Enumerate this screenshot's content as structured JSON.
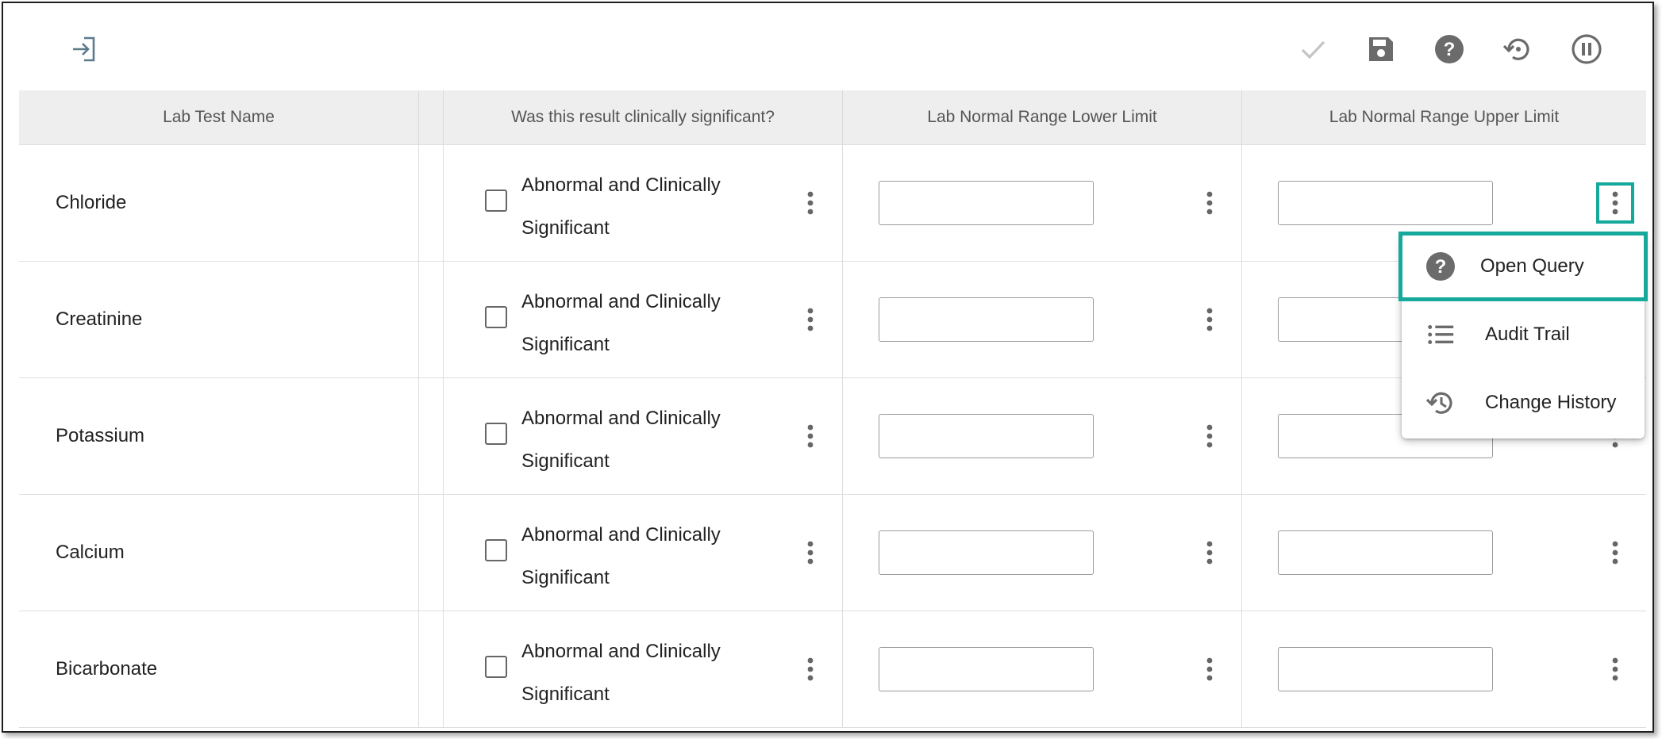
{
  "toolbar": {
    "exit_icon": "sign-in-arrow-icon",
    "confirm_icon": "check-icon",
    "save_icon": "floppy-save-icon",
    "help_icon": "help-circle-icon",
    "history_icon": "history-restore-icon",
    "pause_icon": "pause-circle-icon"
  },
  "table": {
    "headers": {
      "lab_test_name": "Lab Test Name",
      "clinically_significant": "Was this result clinically significant?",
      "lower_limit": "Lab Normal Range Lower Limit",
      "upper_limit": "Lab Normal Range Upper Limit"
    },
    "rows": [
      {
        "name": "Chloride",
        "checkbox_label": "Abnormal and Clinically Significant",
        "lower_value": "",
        "upper_value": ""
      },
      {
        "name": "Creatinine",
        "checkbox_label": "Abnormal and Clinically Significant",
        "lower_value": "",
        "upper_value": ""
      },
      {
        "name": "Potassium",
        "checkbox_label": "Abnormal and Clinically Significant",
        "lower_value": "",
        "upper_value": ""
      },
      {
        "name": "Calcium",
        "checkbox_label": "Abnormal and Clinically Significant",
        "lower_value": "",
        "upper_value": ""
      },
      {
        "name": "Bicarbonate",
        "checkbox_label": "Abnormal and Clinically Significant",
        "lower_value": "",
        "upper_value": ""
      }
    ]
  },
  "context_menu": {
    "items": [
      {
        "label": "Open Query",
        "icon": "help-circle-icon",
        "highlighted": true
      },
      {
        "label": "Audit Trail",
        "icon": "list-icon",
        "highlighted": false
      },
      {
        "label": "Change History",
        "icon": "history-icon",
        "highlighted": false
      }
    ]
  },
  "colors": {
    "highlight": "#14a99a",
    "icon_gray": "#6b6b6b",
    "header_bg": "#eeeeee"
  }
}
